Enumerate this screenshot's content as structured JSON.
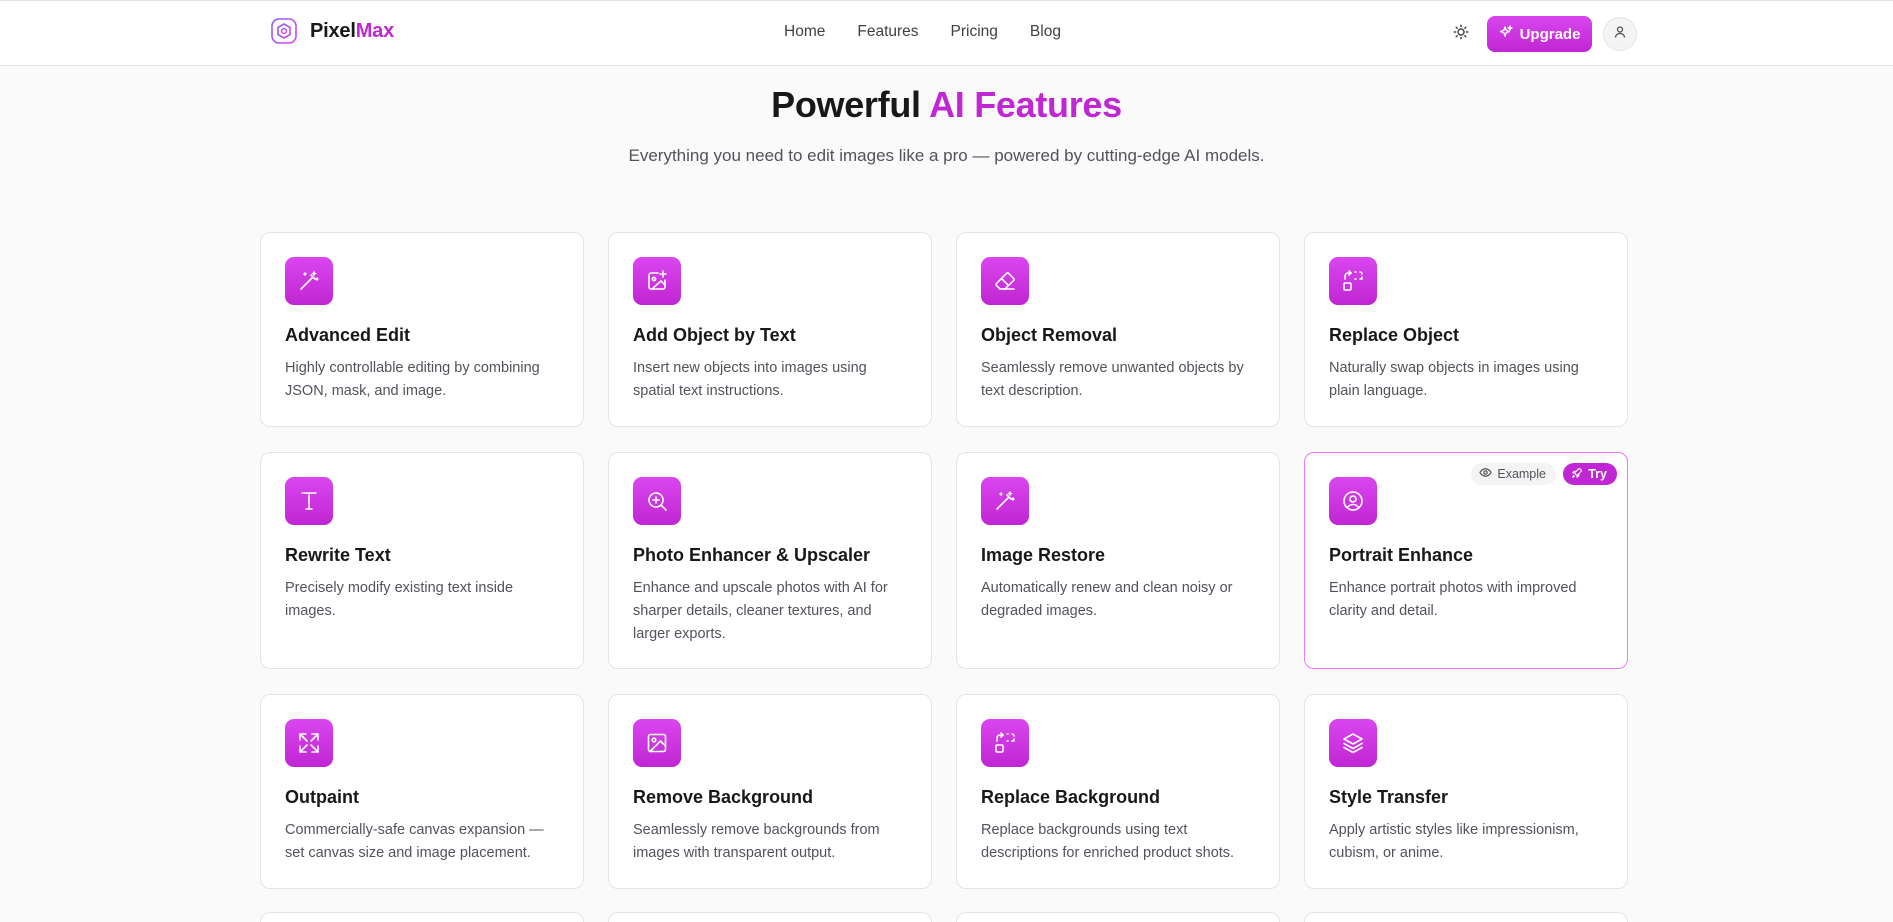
{
  "brand": {
    "name_part1": "Pixel",
    "name_part2": "Max"
  },
  "nav": {
    "items": [
      "Home",
      "Features",
      "Pricing",
      "Blog"
    ]
  },
  "header": {
    "upgrade_label": "Upgrade"
  },
  "hero": {
    "title_part1": "Powerful ",
    "title_part2": "AI Features",
    "subtitle": "Everything you need to edit images like a pro — powered by cutting-edge AI models."
  },
  "features": [
    {
      "title": "Advanced Edit",
      "desc": "Highly controllable editing by combining JSON, mask, and image.",
      "icon": "magic-wand-icon"
    },
    {
      "title": "Add Object by Text",
      "desc": "Insert new objects into images using spatial text instructions.",
      "icon": "image-plus-icon"
    },
    {
      "title": "Object Removal",
      "desc": "Seamlessly remove unwanted objects by text description.",
      "icon": "eraser-icon"
    },
    {
      "title": "Replace Object",
      "desc": "Naturally swap objects in images using plain language.",
      "icon": "replace-icon"
    },
    {
      "title": "Rewrite Text",
      "desc": "Precisely modify existing text inside images.",
      "icon": "type-icon"
    },
    {
      "title": "Photo Enhancer & Upscaler",
      "desc": "Enhance and upscale photos with AI for sharper details, cleaner textures, and larger exports.",
      "icon": "zoom-in-icon"
    },
    {
      "title": "Image Restore",
      "desc": "Automatically renew and clean noisy or degraded images.",
      "icon": "magic-wand-icon"
    },
    {
      "title": "Portrait Enhance",
      "desc": "Enhance portrait photos with improved clarity and detail.",
      "icon": "user-circle-icon",
      "badges": {
        "example": "Example",
        "try": "Try"
      }
    },
    {
      "title": "Outpaint",
      "desc": "Commercially-safe canvas expansion — set canvas size and image placement.",
      "icon": "expand-icon"
    },
    {
      "title": "Remove Background",
      "desc": "Seamlessly remove backgrounds from images with transparent output.",
      "icon": "image-icon"
    },
    {
      "title": "Replace Background",
      "desc": "Replace backgrounds using text descriptions for enriched product shots.",
      "icon": "replace-icon"
    },
    {
      "title": "Style Transfer",
      "desc": "Apply artistic styles like impressionism, cubism, or anime.",
      "icon": "layers-icon"
    }
  ],
  "colors": {
    "accent": "#c026d3",
    "accent_light": "#d946ef",
    "text": "#18181b",
    "muted": "#52525b",
    "border": "#e4e4e7"
  }
}
